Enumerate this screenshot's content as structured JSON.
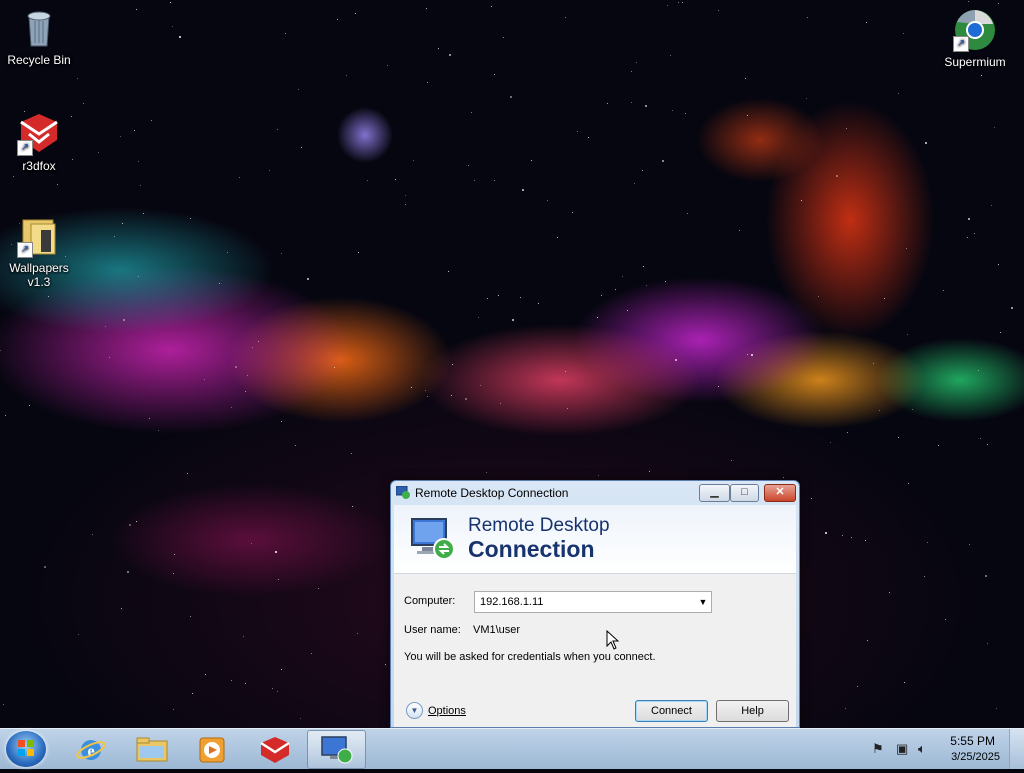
{
  "desktop": {
    "icons": [
      {
        "label": "Recycle Bin",
        "icon": "recycle-bin-icon"
      },
      {
        "label": "r3dfox",
        "icon": "r3dfox-icon"
      },
      {
        "label": "Wallpapers v1.3",
        "icon": "folder-icon"
      },
      {
        "label": "Supermium",
        "icon": "supermium-icon"
      }
    ]
  },
  "dialog": {
    "title": "Remote Desktop Connection",
    "banner_line1": "Remote Desktop",
    "banner_line2": "Connection",
    "computer_label": "Computer:",
    "computer_value": "192.168.1.11",
    "username_label": "User name:",
    "username_value": "VM1\\user",
    "note": "You will be asked for credentials when you connect.",
    "options_label": "Options",
    "connect_label": "Connect",
    "help_label": "Help"
  },
  "taskbar": {
    "items": [
      "start-button",
      "internet-explorer-icon",
      "file-explorer-icon",
      "media-player-icon",
      "r3dfox-icon",
      "remote-desktop-icon"
    ],
    "active_item": "remote-desktop-icon",
    "time": "5:55 PM",
    "date": "3/25/2025"
  }
}
